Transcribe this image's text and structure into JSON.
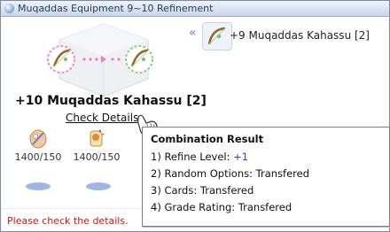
{
  "window": {
    "title": "Muqaddas Equipment 9~10 Refinement"
  },
  "preview": {
    "target_item": "+9 Muqaddas Kahassu [2]"
  },
  "result": {
    "item_name": "+10 Muqaddas Kahassu [2]",
    "check_details": "Check Details"
  },
  "materials": [
    {
      "count": "1400/150",
      "icon": "feather-crystal-icon"
    },
    {
      "count": "1400/150",
      "icon": "scroll-rune-icon"
    }
  ],
  "status": {
    "message": "Please check the details."
  },
  "tooltip": {
    "title": "Combination Result",
    "lines": [
      {
        "label": "1) Refine Level: ",
        "value": "+1"
      },
      {
        "label": "2) Random Options: ",
        "value": "Transfered"
      },
      {
        "label": "3) Cards: ",
        "value": "Transfered"
      },
      {
        "label": "4) Grade Rating: ",
        "value": "Transfered"
      }
    ]
  },
  "colors": {
    "title_bg": "#c9d6ea",
    "status_text": "#e01010",
    "refine_value": "#1b4fd0",
    "accent": "#7d9bd1"
  }
}
